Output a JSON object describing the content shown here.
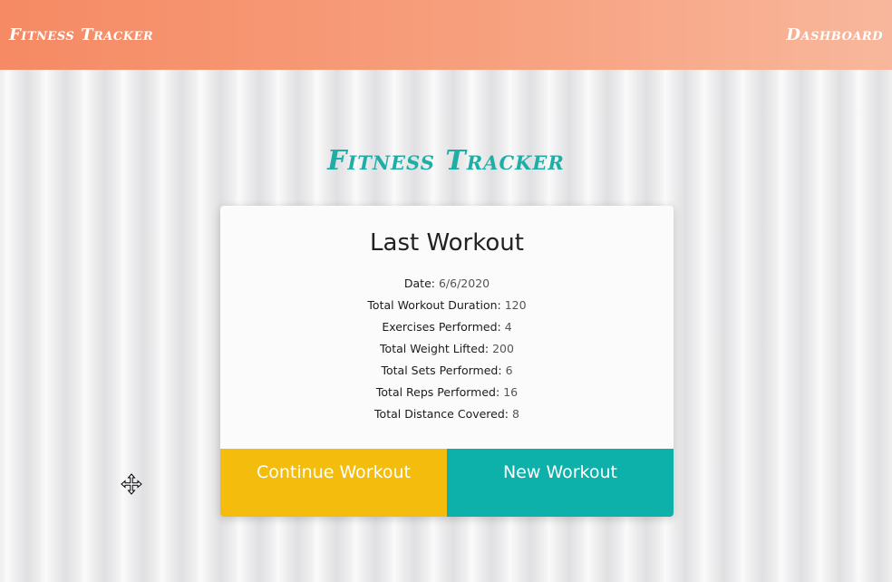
{
  "nav": {
    "brand": "Fitness Tracker",
    "dashboard_link": "Dashboard"
  },
  "hero": {
    "title": "Fitness Tracker"
  },
  "card": {
    "title": "Last Workout",
    "stats": [
      {
        "label": "Date:",
        "value": "6/6/2020"
      },
      {
        "label": "Total Workout Duration:",
        "value": "120"
      },
      {
        "label": "Exercises Performed:",
        "value": "4"
      },
      {
        "label": "Total Weight Lifted:",
        "value": "200"
      },
      {
        "label": "Total Sets Performed:",
        "value": "6"
      },
      {
        "label": "Total Reps Performed:",
        "value": "16"
      },
      {
        "label": "Total Distance Covered:",
        "value": "8"
      }
    ],
    "continue_label": "Continue Workout",
    "new_label": "New Workout"
  },
  "colors": {
    "navbar_start": "#f58a64",
    "navbar_end": "#f8b79c",
    "accent_teal": "#1faea6",
    "continue_yellow": "#f4bc0c",
    "new_teal": "#0eb1a9"
  },
  "icons": {
    "cursor": "move-cursor-icon"
  }
}
